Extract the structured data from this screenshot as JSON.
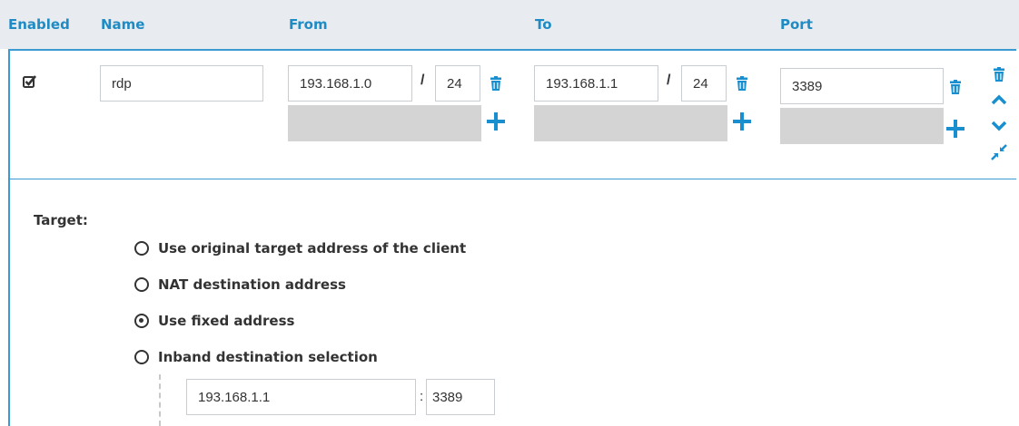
{
  "header": {
    "partial_title": "",
    "columns": {
      "enabled": "Enabled",
      "name": "Name",
      "from": "From",
      "to": "To",
      "port": "Port"
    }
  },
  "row": {
    "enabled": true,
    "name": "rdp",
    "from": {
      "address": "193.168.1.0",
      "separator": "/",
      "prefix": "24"
    },
    "to": {
      "address": "193.168.1.1",
      "separator": "/",
      "prefix": "24"
    },
    "port": "3389"
  },
  "target": {
    "label": "Target:",
    "options": [
      {
        "label": "Use original target address of the client",
        "selected": false
      },
      {
        "label": "NAT destination address",
        "selected": false
      },
      {
        "label": "Use fixed address",
        "selected": true
      },
      {
        "label": "Inband destination selection",
        "selected": false
      }
    ],
    "fixed_address": "193.168.1.1",
    "fixed_separator": ":",
    "fixed_port": "3389"
  },
  "colors": {
    "accent": "#1f8bc4",
    "icon_blue": "#1a8fd0",
    "header_bg": "#e8ecf0",
    "disabled_grey": "#d4d4d4"
  },
  "icons": {
    "checkbox": "checkbox-checked-icon",
    "trash": "trash-icon",
    "plus": "plus-icon",
    "up": "chevron-up-icon",
    "down": "chevron-down-icon",
    "collapse": "collapse-icon"
  }
}
